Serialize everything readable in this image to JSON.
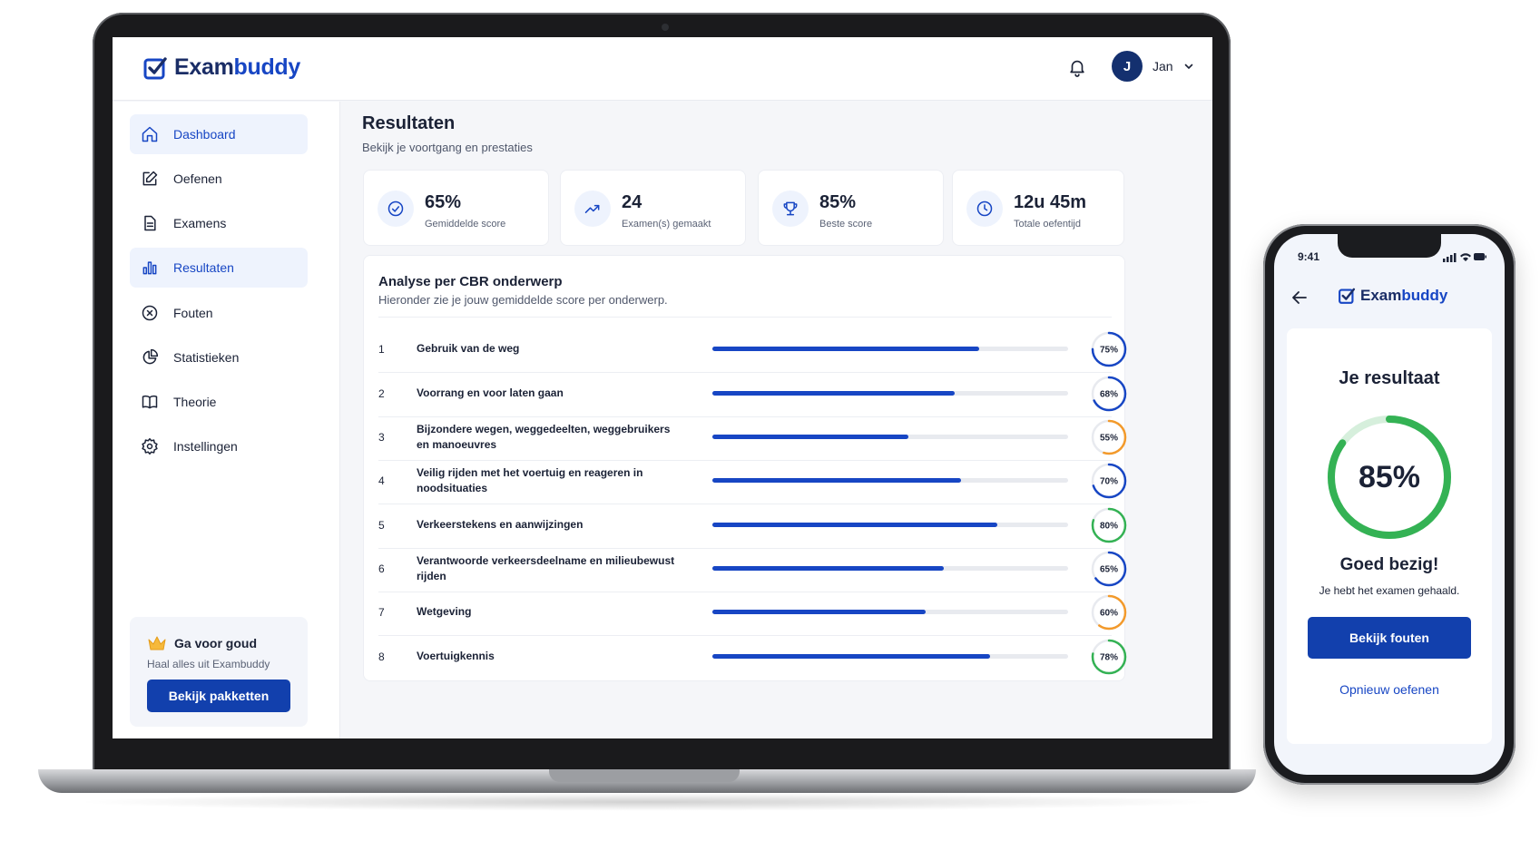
{
  "app": {
    "brand_prefix": "Exam",
    "brand_suffix": "buddy",
    "accent_color": "#1746c4",
    "brand_dark_color": "#1a2d66"
  },
  "header": {
    "notifications_icon": "bell-icon",
    "avatar_initial": "J",
    "user_name": "Jan"
  },
  "sidebar": {
    "items": [
      {
        "label": "Dashboard",
        "icon": "home-icon",
        "active": true
      },
      {
        "label": "Oefenen",
        "icon": "edit-icon",
        "active": false
      },
      {
        "label": "Examens",
        "icon": "document-icon",
        "active": false
      },
      {
        "label": "Resultaten",
        "icon": "bar-chart-icon",
        "active": true
      },
      {
        "label": "Fouten",
        "icon": "x-circle-icon",
        "active": false
      },
      {
        "label": "Statistieken",
        "icon": "pie-chart-icon",
        "active": false
      },
      {
        "label": "Theorie",
        "icon": "book-icon",
        "active": false
      },
      {
        "label": "Instellingen",
        "icon": "gear-icon",
        "active": false
      }
    ],
    "promo": {
      "title": "Ga voor goud",
      "subtitle": "Haal alles uit Exambuddy",
      "button": "Bekijk pakketten",
      "icon": "crown-icon"
    }
  },
  "main": {
    "title": "Resultaten",
    "subtitle": "Bekijk je voortgang en prestaties",
    "stats": [
      {
        "value": "65%",
        "label": "Gemiddelde score",
        "icon": "check-circle-icon"
      },
      {
        "value": "24",
        "label": "Examen(s) gemaakt",
        "icon": "trend-up-icon"
      },
      {
        "value": "85%",
        "label": "Beste score",
        "icon": "trophy-icon"
      },
      {
        "value": "12u 45m",
        "label": "Totale oefentijd",
        "icon": "clock-icon"
      }
    ],
    "analysis": {
      "title": "Analyse per CBR onderwerp",
      "subtitle": "Hieronder zie je jouw gemiddelde score per onderwerp.",
      "topics": [
        {
          "num": "1",
          "name": "Gebruik van de weg",
          "score": 75,
          "label": "75%",
          "color": "#1746c4"
        },
        {
          "num": "2",
          "name": "Voorrang en voor laten gaan",
          "score": 68,
          "label": "68%",
          "color": "#1746c4"
        },
        {
          "num": "3",
          "name": "Bijzondere wegen, weggedeelten, weggebruikers en manoeuvres",
          "score": 55,
          "label": "55%",
          "color": "#f39a2b"
        },
        {
          "num": "4",
          "name": "Veilig rijden met het voertuig en reageren in noodsituaties",
          "score": 70,
          "label": "70%",
          "color": "#1746c4"
        },
        {
          "num": "5",
          "name": "Verkeerstekens en aanwijzingen",
          "score": 80,
          "label": "80%",
          "color": "#34b254"
        },
        {
          "num": "6",
          "name": "Verantwoorde verkeersdeelname en milieubewust rijden",
          "score": 65,
          "label": "65%",
          "color": "#1746c4"
        },
        {
          "num": "7",
          "name": "Wetgeving",
          "score": 60,
          "label": "60%",
          "color": "#f39a2b"
        },
        {
          "num": "8",
          "name": "Voertuigkennis",
          "score": 78,
          "label": "78%",
          "color": "#34b254"
        }
      ]
    }
  },
  "phone": {
    "time": "9:41",
    "back_icon": "arrow-left-icon",
    "title": "Je resultaat",
    "score": 85,
    "score_label": "85%",
    "score_color": "#34b254",
    "message": "Goed bezig!",
    "message_sub": "Je hebt het examen gehaald.",
    "primary_button": "Bekijk fouten",
    "secondary_link": "Opnieuw oefenen"
  }
}
